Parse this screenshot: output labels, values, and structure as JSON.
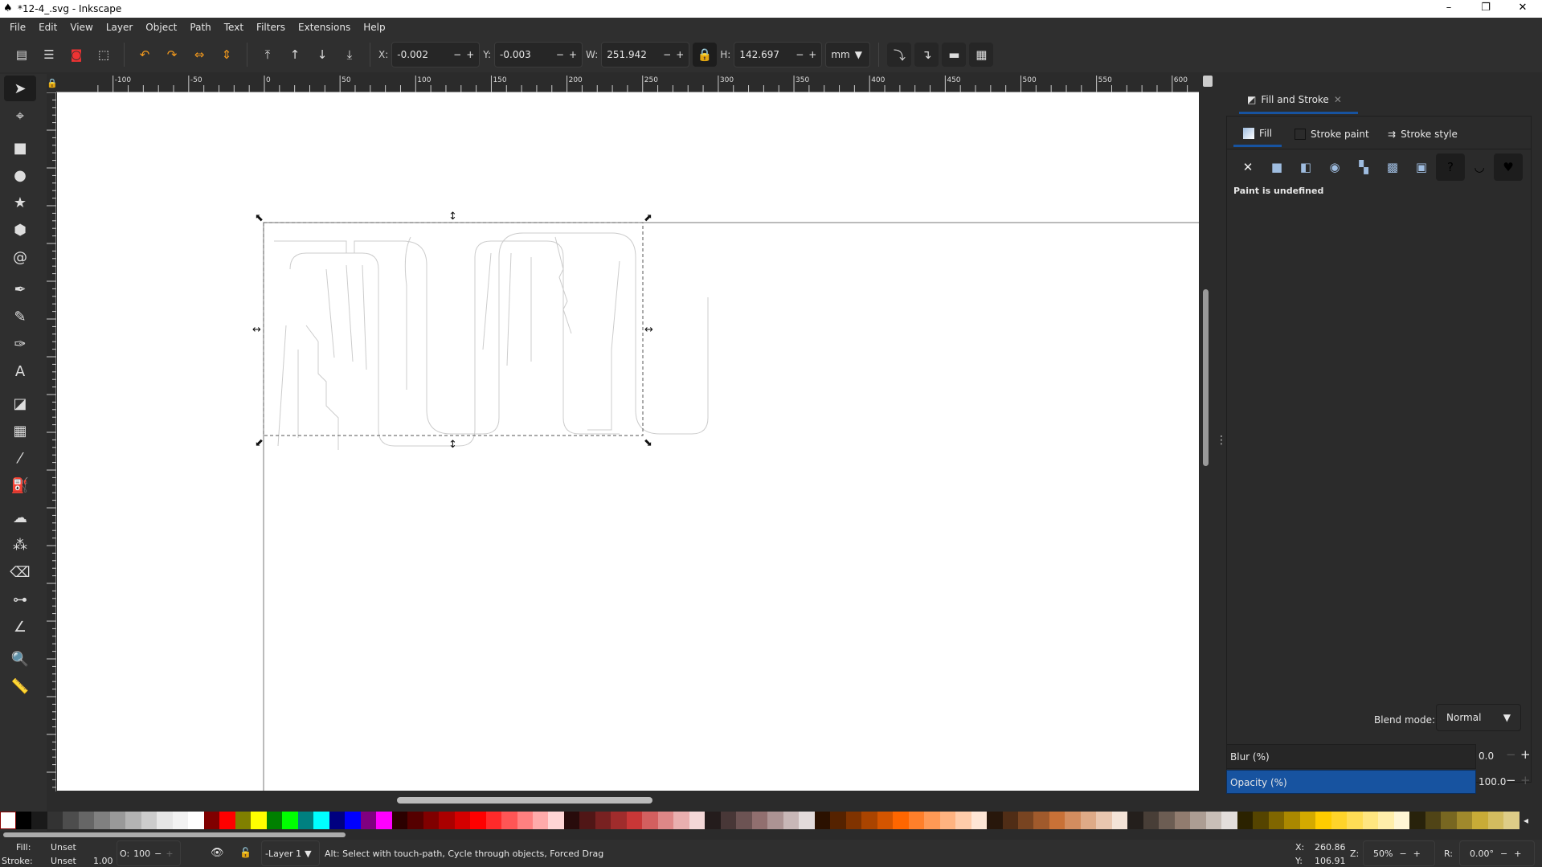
{
  "window": {
    "title": "*12-4_.svg - Inkscape",
    "minimize": "–",
    "maximize": "❐",
    "close": "✕"
  },
  "menu": [
    "File",
    "Edit",
    "View",
    "Layer",
    "Object",
    "Path",
    "Text",
    "Filters",
    "Extensions",
    "Help"
  ],
  "toolbar": {
    "x_label": "X:",
    "x_value": "-0.002",
    "y_label": "Y:",
    "y_value": "-0.003",
    "w_label": "W:",
    "w_value": "251.942",
    "h_label": "H:",
    "h_value": "142.697",
    "unit": "mm",
    "minus": "−",
    "plus": "+"
  },
  "ruler": {
    "labels": [
      "-100",
      "-50",
      "0",
      "50",
      "100",
      "150",
      "200",
      "250",
      "300",
      "350",
      "400",
      "450",
      "500",
      "550",
      "600"
    ]
  },
  "tools": [
    "selector-icon",
    "node-icon",
    "rectangle-icon",
    "ellipse-icon",
    "star-icon",
    "box3d-icon",
    "spiral-icon",
    "pen-icon",
    "pencil-icon",
    "calligraphy-icon",
    "text-icon",
    "gradient-icon",
    "mesh-icon",
    "dropper-icon",
    "paint-bucket-icon",
    "tweak-icon",
    "spray-icon",
    "eraser-icon",
    "connector-icon",
    "lpe-tool-icon",
    "zoom-icon",
    "measure-icon"
  ],
  "panel": {
    "tab_title": "Fill and Stroke",
    "tab_close": "✕",
    "subtabs": [
      "Fill",
      "Stroke paint",
      "Stroke style"
    ],
    "paint_modes": [
      "no-paint",
      "flat-color",
      "linear-gradient",
      "radial-gradient",
      "mesh-gradient",
      "pattern",
      "swatch",
      "unset",
      "evenodd",
      "nonzero"
    ],
    "paint_status": "Paint is undefined",
    "blend_label": "Blend mode:",
    "blend_value": "Normal",
    "blur_label": "Blur (%)",
    "blur_value": "0.0",
    "opacity_label": "Opacity (%)",
    "opacity_value": "100.0",
    "accent": "#1753a0"
  },
  "palette": [
    "#000000",
    "#1a1a1a",
    "#333333",
    "#4d4d4d",
    "#666666",
    "#808080",
    "#999999",
    "#b3b3b3",
    "#cccccc",
    "#e6e6e6",
    "#f2f2f2",
    "#ffffff",
    "#800000",
    "#ff0000",
    "#808000",
    "#ffff00",
    "#008000",
    "#00ff00",
    "#008080",
    "#00ffff",
    "#000080",
    "#0000ff",
    "#800080",
    "#ff00ff",
    "#2b0000",
    "#550000",
    "#800000",
    "#aa0000",
    "#d40000",
    "#ff0000",
    "#ff2a2a",
    "#ff5555",
    "#ff8080",
    "#ffaaaa",
    "#ffd5d5",
    "#280b0b",
    "#501616",
    "#782121",
    "#a02c2c",
    "#c83737",
    "#d35f5f",
    "#de8787",
    "#e9afaf",
    "#f4d7d7",
    "#241c1c",
    "#483737",
    "#6c5353",
    "#916f6f",
    "#ac9393",
    "#c8b7b7",
    "#e3dbdb",
    "#2b1100",
    "#552200",
    "#803300",
    "#aa4400",
    "#d45500",
    "#ff6600",
    "#ff7f2a",
    "#ff9955",
    "#ffb380",
    "#ffccaa",
    "#ffe6d5",
    "#28170b",
    "#502d16",
    "#784421",
    "#a05a2c",
    "#c87137",
    "#d38d5f",
    "#deaa87",
    "#e9c6af",
    "#f4e3d7",
    "#241f1c",
    "#483e37",
    "#6c5d53",
    "#917c6f",
    "#ac9d93",
    "#c8beb7",
    "#e3dedb",
    "#2b2200",
    "#554400",
    "#806600",
    "#aa8800",
    "#d4aa00",
    "#ffcc00",
    "#ffd42a",
    "#ffdd55",
    "#ffe680",
    "#ffeeaa",
    "#fff6d5",
    "#28220b",
    "#504416",
    "#786721",
    "#a0892c",
    "#c8ab37",
    "#d3bc5f",
    "#decd87"
  ],
  "status": {
    "fill_label": "Fill:",
    "fill_value": "Unset",
    "stroke_label": "Stroke:",
    "stroke_value": "Unset",
    "stroke_width": "1.00",
    "opacity_label": "O:",
    "opacity_value": "100",
    "layer": "-Layer 1",
    "message": "Alt: Select with touch-path, Cycle through objects, Forced Drag",
    "cx_label": "X:",
    "cx": "260.86",
    "cy_label": "Y:",
    "cy": "106.91",
    "zoom_label": "Z:",
    "zoom": "50%",
    "rotate_label": "R:",
    "rotate": "0.00°"
  }
}
